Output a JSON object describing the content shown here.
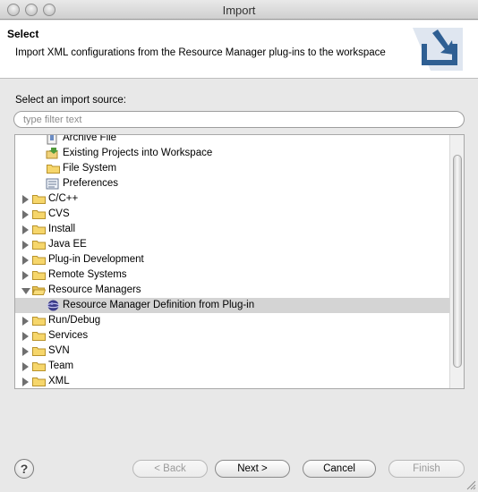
{
  "window": {
    "title": "Import"
  },
  "banner": {
    "title": "Select",
    "description": "Import XML configurations from the Resource Manager plug-ins to the workspace",
    "icon": "import-wizard-icon"
  },
  "source_label": "Select an import source:",
  "filter": {
    "placeholder": "type filter text",
    "value": ""
  },
  "tree": {
    "items": [
      {
        "label": "Archive File",
        "level": 1,
        "icon": "archive-file-icon"
      },
      {
        "label": "Existing Projects into Workspace",
        "level": 1,
        "icon": "existing-projects-icon"
      },
      {
        "label": "File System",
        "level": 1,
        "icon": "folder-icon"
      },
      {
        "label": "Preferences",
        "level": 1,
        "icon": "preferences-icon"
      },
      {
        "label": "C/C++",
        "level": 0,
        "icon": "folder-icon",
        "expanded": false
      },
      {
        "label": "CVS",
        "level": 0,
        "icon": "folder-icon",
        "expanded": false
      },
      {
        "label": "Install",
        "level": 0,
        "icon": "folder-icon",
        "expanded": false
      },
      {
        "label": "Java EE",
        "level": 0,
        "icon": "folder-icon",
        "expanded": false
      },
      {
        "label": "Plug-in Development",
        "level": 0,
        "icon": "folder-icon",
        "expanded": false
      },
      {
        "label": "Remote Systems",
        "level": 0,
        "icon": "folder-icon",
        "expanded": false
      },
      {
        "label": "Resource Managers",
        "level": 0,
        "icon": "folder-open-icon",
        "expanded": true
      },
      {
        "label": "Resource Manager Definition from Plug-in",
        "level": 1,
        "icon": "resource-manager-icon",
        "selected": true
      },
      {
        "label": "Run/Debug",
        "level": 0,
        "icon": "folder-icon",
        "expanded": false
      },
      {
        "label": "Services",
        "level": 0,
        "icon": "folder-icon",
        "expanded": false
      },
      {
        "label": "SVN",
        "level": 0,
        "icon": "folder-icon",
        "expanded": false
      },
      {
        "label": "Team",
        "level": 0,
        "icon": "folder-icon",
        "expanded": false
      },
      {
        "label": "XML",
        "level": 0,
        "icon": "folder-icon",
        "expanded": false
      }
    ]
  },
  "buttons": {
    "help": "?",
    "back": "< Back",
    "next": "Next >",
    "cancel": "Cancel",
    "finish": "Finish"
  },
  "colors": {
    "selection": "#d4d4d4",
    "banner_bg": "#ffffff",
    "dialog_bg": "#e8e8e8"
  }
}
